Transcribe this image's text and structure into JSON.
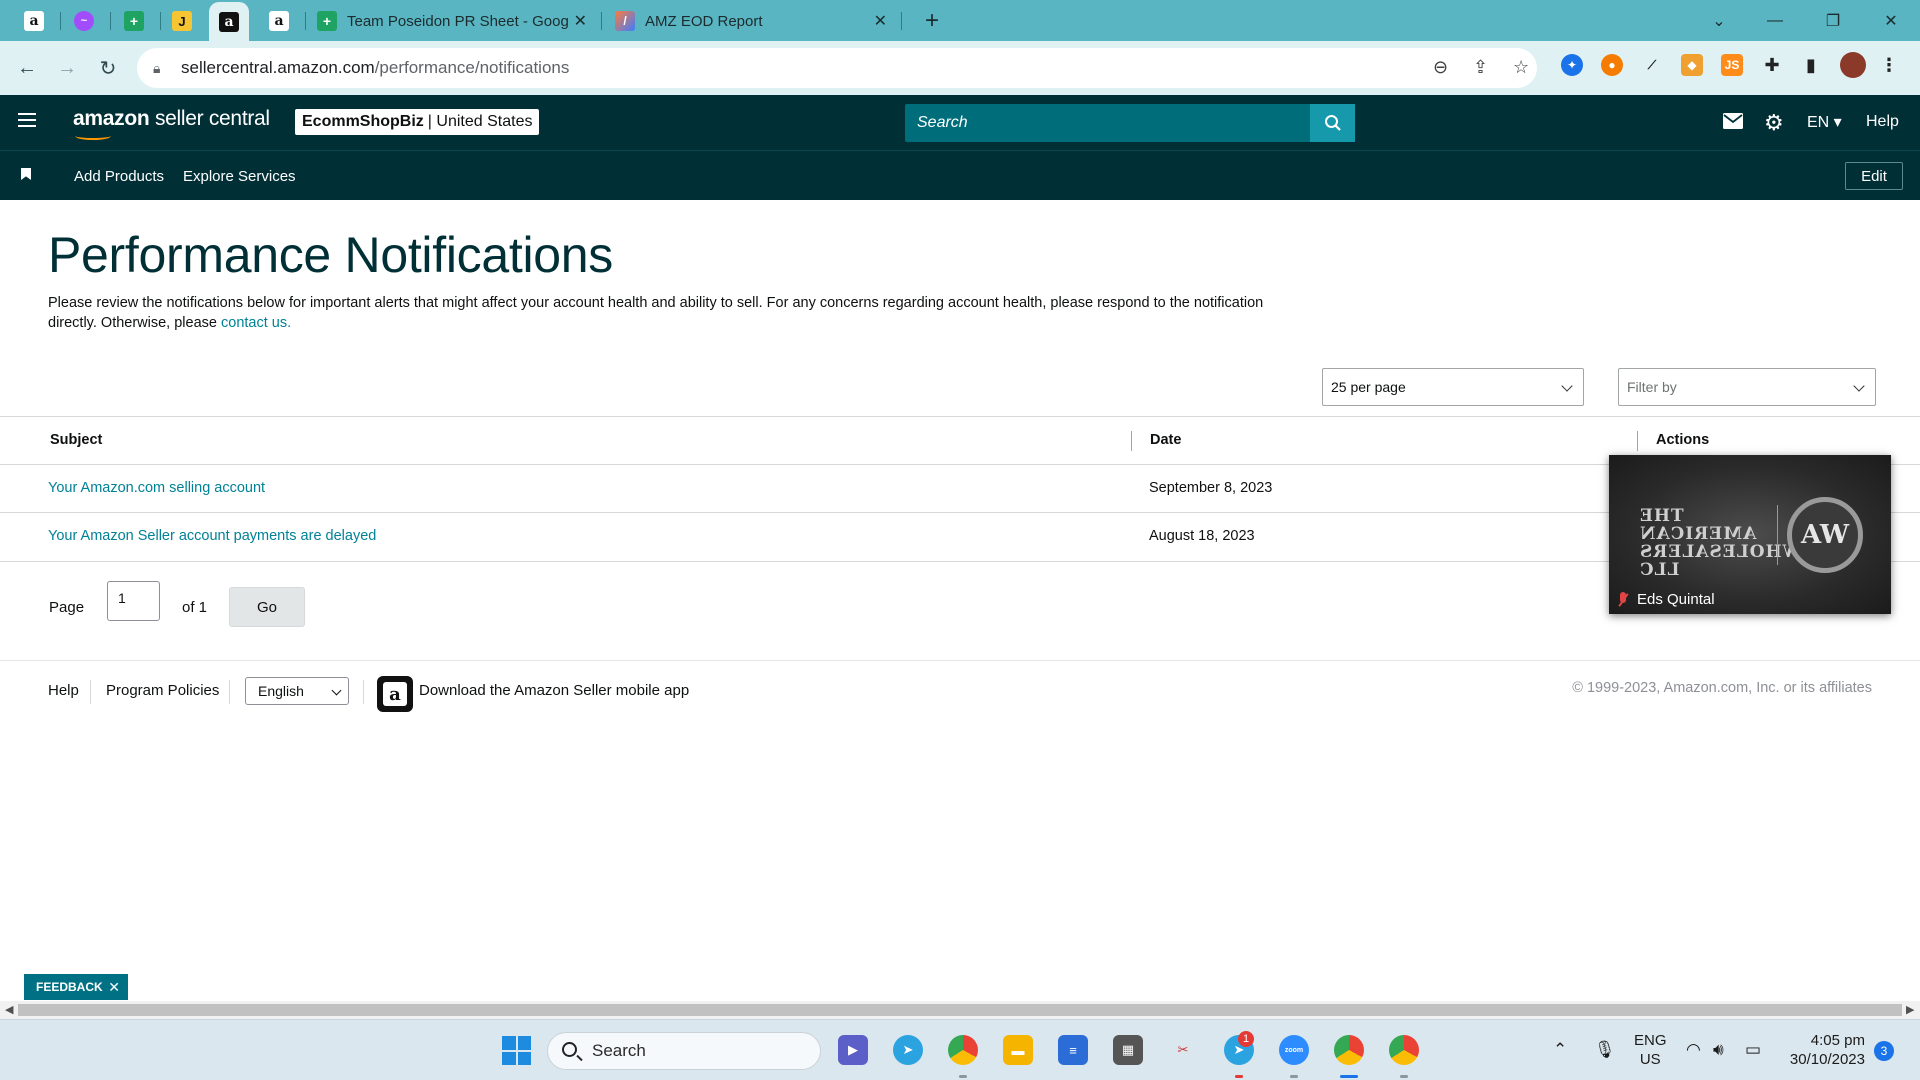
{
  "browser": {
    "tabs": [
      {
        "icon": "amazon-icon",
        "glyph": "a"
      },
      {
        "icon": "messenger-icon",
        "glyph": "~"
      },
      {
        "icon": "google-sheets-icon",
        "glyph": "+"
      },
      {
        "icon": "jungle-scout-icon",
        "glyph": "J"
      },
      {
        "icon": "amazon-seller-icon",
        "glyph": "a",
        "active": true
      },
      {
        "icon": "amazon-icon",
        "glyph": "a"
      }
    ],
    "wide_tabs": [
      {
        "title": "Team Poseidon PR Sheet - Goog",
        "icon": "google-sheets-icon"
      },
      {
        "title": "AMZ EOD Report",
        "icon": "report-icon"
      }
    ],
    "url_host": "sellercentral.amazon.com",
    "url_path": "/performance/notifications"
  },
  "header": {
    "logo_bold": "amazon",
    "logo_rest": "seller central",
    "store_name": "EcommShopBiz",
    "store_region": "United States",
    "search_placeholder": "Search",
    "language": "EN",
    "help": "Help"
  },
  "subnav": {
    "links": [
      "Add Products",
      "Explore Services"
    ],
    "edit": "Edit"
  },
  "page": {
    "title": "Performance Notifications",
    "intro": "Please review the notifications below for important alerts that might affect your account health and ability to sell. For any concerns regarding account health, please respond to the notification directly. Otherwise, please ",
    "intro_link": "contact us.",
    "per_page": "25 per page",
    "filter_placeholder": "Filter by"
  },
  "table": {
    "headers": {
      "subject": "Subject",
      "date": "Date",
      "actions": "Actions"
    },
    "rows": [
      {
        "subject": "Your Amazon.com selling account",
        "date": "September 8, 2023"
      },
      {
        "subject": "Your Amazon Seller account payments are delayed",
        "date": "August 18, 2023"
      }
    ]
  },
  "pager": {
    "label": "Page",
    "value": "1",
    "of": "of 1",
    "go": "Go"
  },
  "footer": {
    "help": "Help",
    "program_policies": "Program Policies",
    "language": "English",
    "download_app": "Download the Amazon Seller mobile app",
    "copyright": "© 1999-2023, Amazon.com, Inc. or its affiliates"
  },
  "video_tile": {
    "participant": "Eds Quintal"
  },
  "feedback": {
    "label": "FEEDBACK"
  },
  "taskbar": {
    "search": "Search",
    "lang_top": "ENG",
    "lang_bottom": "US",
    "time": "4:05 pm",
    "date": "30/10/2023",
    "notifications": "3",
    "telegram_badge": "1",
    "zoom_label": "zoom"
  },
  "colors": {
    "header_bg": "#002f36",
    "link": "#008296",
    "search_bg": "#006e7a",
    "search_btn": "#1599ab",
    "tabstrip": "#59b5c2"
  }
}
